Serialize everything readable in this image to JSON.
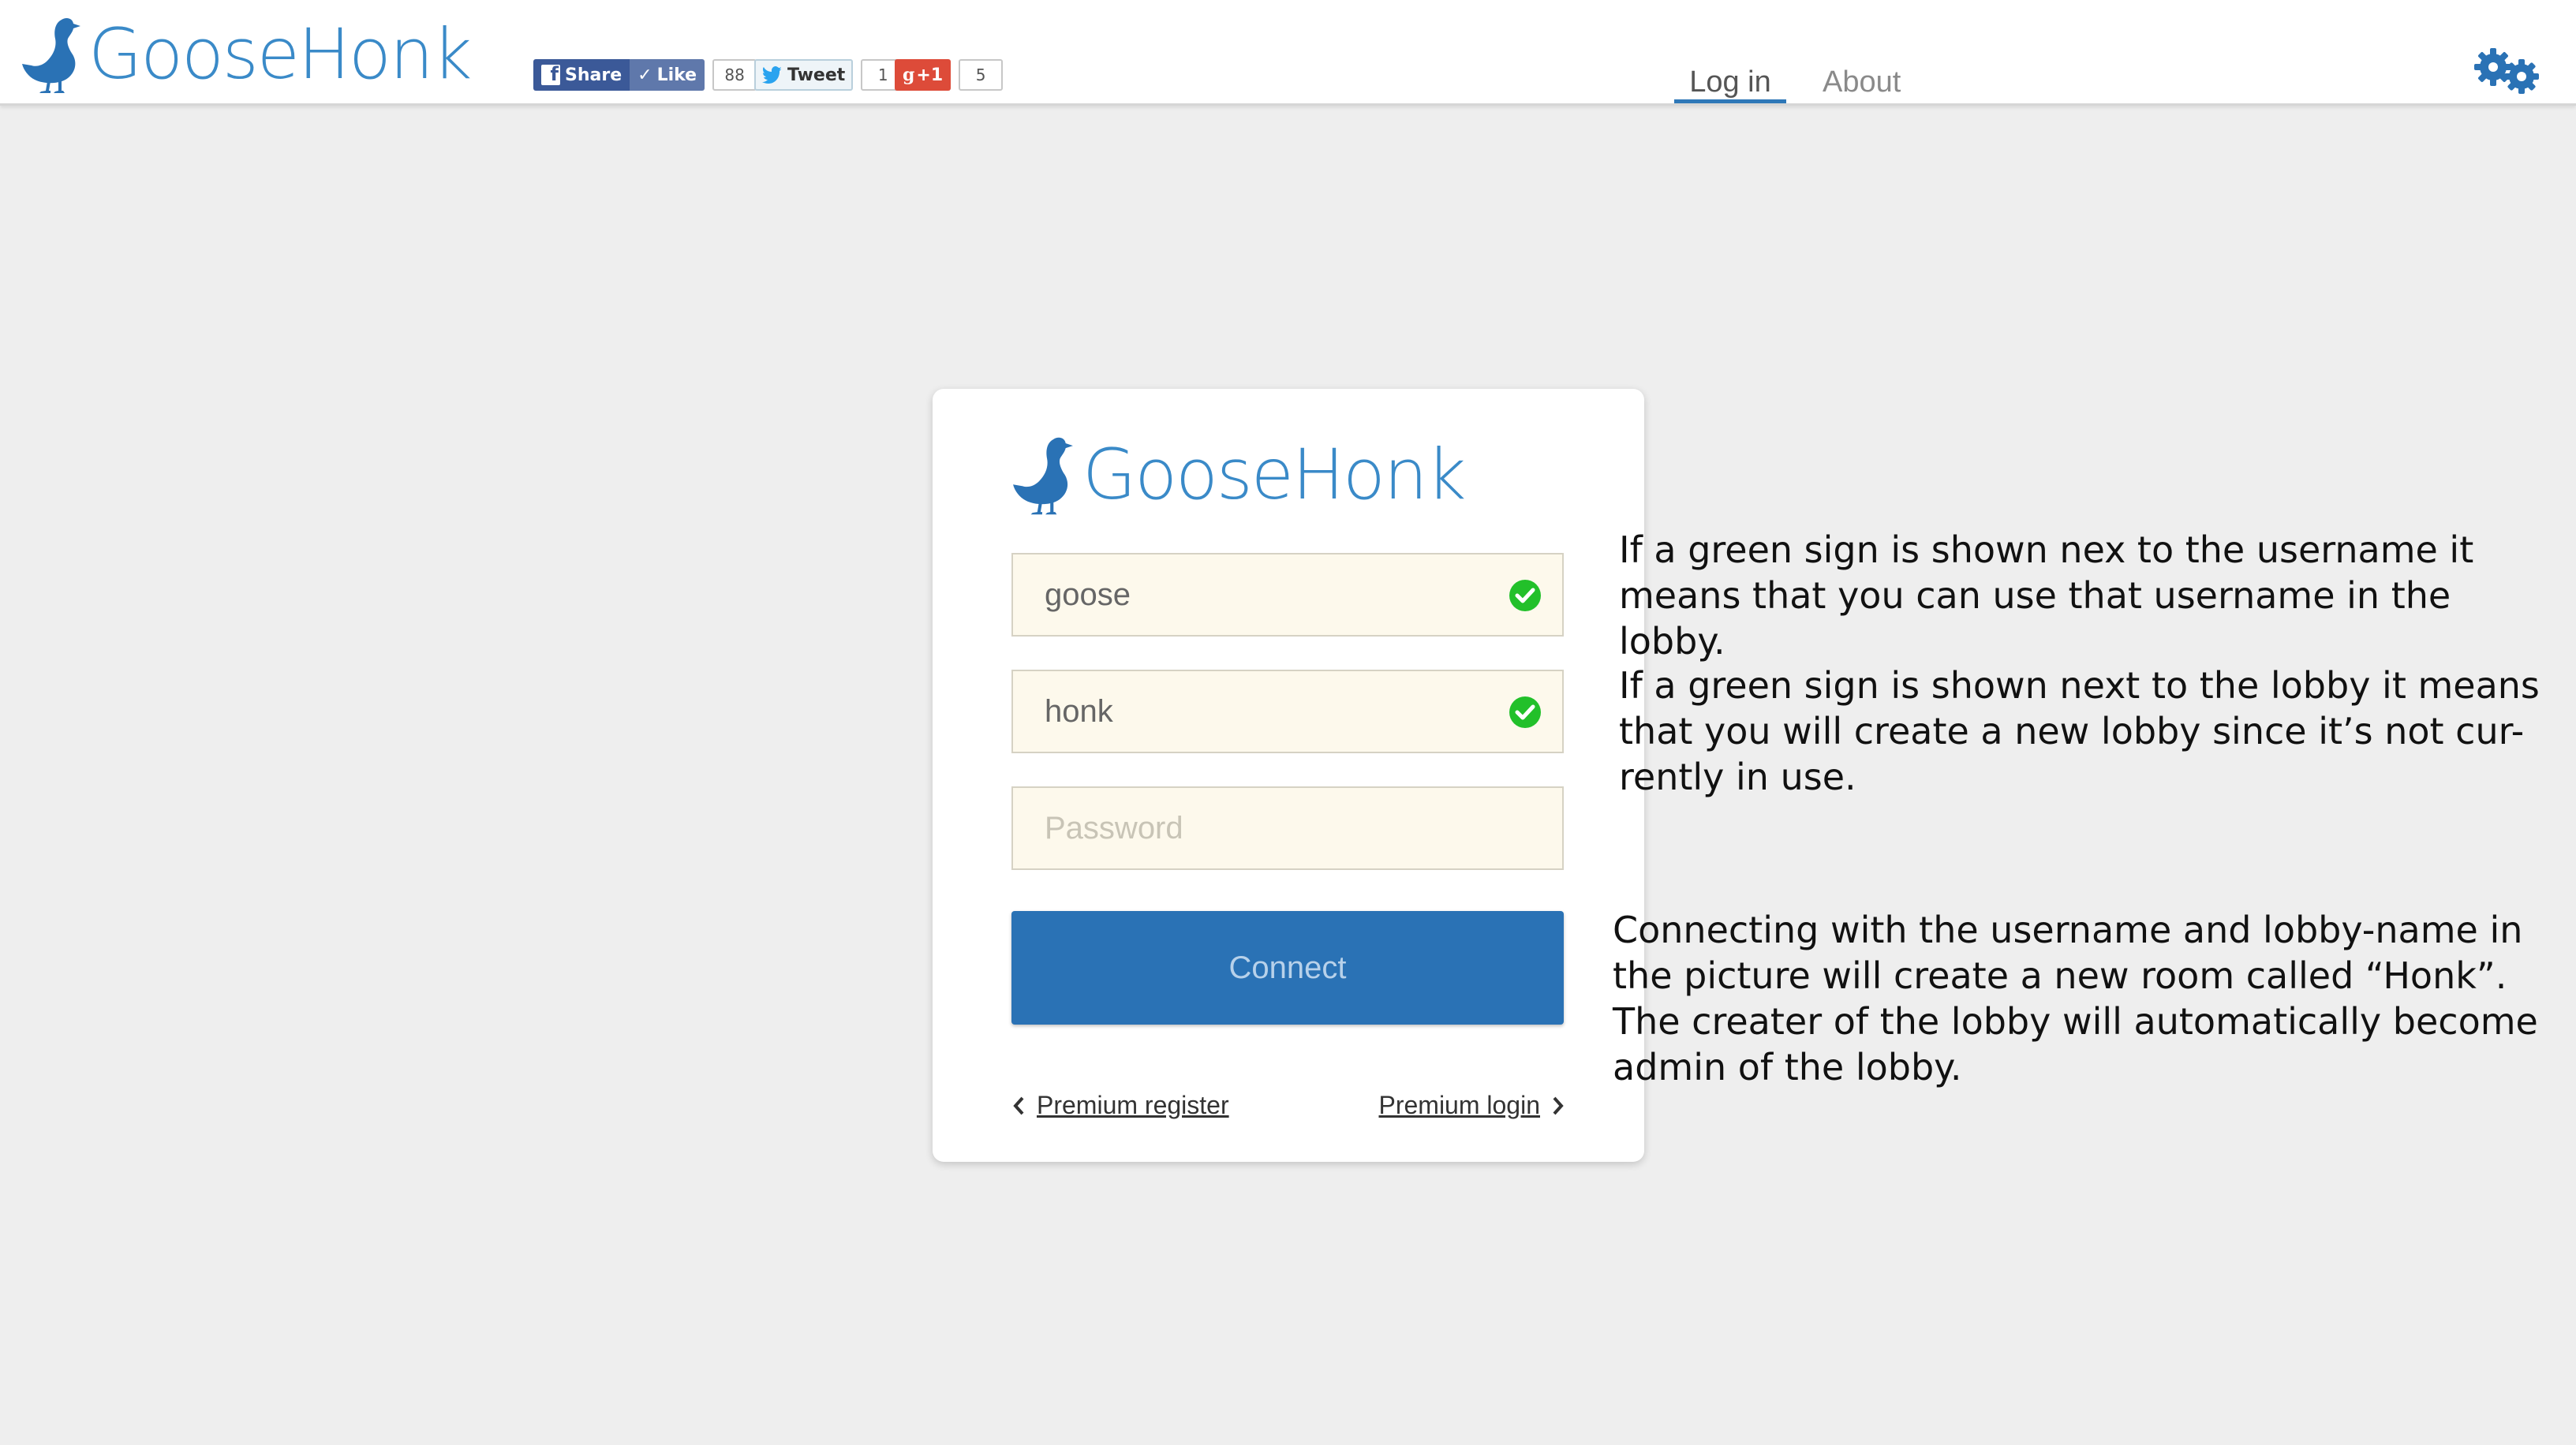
{
  "app": {
    "name": "GooseHonk"
  },
  "social": {
    "fb_share_label": "Share",
    "fb_like_label": "Like",
    "fb_like_count": "88",
    "tweet_label": "Tweet",
    "tweet_count": "1",
    "gplus_label": "+1",
    "gplus_count": "5"
  },
  "nav": {
    "login_label": "Log in",
    "about_label": "About"
  },
  "login": {
    "username_value": "goose",
    "lobby_value": "honk",
    "password_placeholder": "Password",
    "connect_label": "Connect",
    "premium_register_label": "Premium register",
    "premium_login_label": "Premium login"
  },
  "annotations": {
    "note_username": "If a green sign is shown nex to the username it\nmeans that you can use that username in the lobby.",
    "note_lobby": "If a green sign is shown next to the lobby it means\nthat you will create a new lobby since it’s not cur-\nrently in use.",
    "note_connect": "Connecting with the username and lobby-name in\nthe picture will create a new room called “Honk”.\nThe creater of the lobby will automatically become\nadmin of the lobby."
  },
  "colors": {
    "brand_blue": "#3a8ac8",
    "button_blue": "#2a72b5",
    "check_green": "#22c02a",
    "facebook": "#3b5998",
    "gplus": "#dd4b39",
    "background": "#eeeeee"
  },
  "icons": {
    "logo": "goose-icon",
    "settings": "gears-icon",
    "valid": "green-check-icon",
    "prev": "chevron-left-icon",
    "next": "chevron-right-icon"
  }
}
